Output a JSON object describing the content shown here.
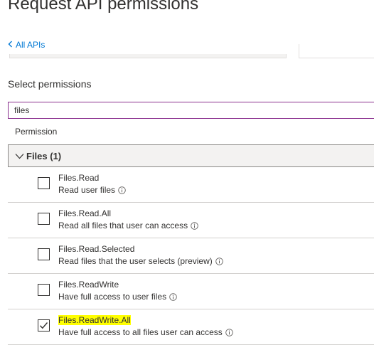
{
  "page": {
    "title": "Request API permissions"
  },
  "nav": {
    "back_label": "All APIs"
  },
  "select": {
    "label": "Select permissions"
  },
  "search": {
    "value": "files",
    "placeholder": ""
  },
  "table": {
    "column_header": "Permission"
  },
  "group": {
    "label": "Files (1)",
    "expanded": true
  },
  "permissions": [
    {
      "name": "Files.Read",
      "description": "Read user files",
      "checked": false,
      "highlighted": false
    },
    {
      "name": "Files.Read.All",
      "description": "Read all files that user can access",
      "checked": false,
      "highlighted": false
    },
    {
      "name": "Files.Read.Selected",
      "description": "Read files that the user selects (preview)",
      "checked": false,
      "highlighted": false
    },
    {
      "name": "Files.ReadWrite",
      "description": "Have full access to user files",
      "checked": false,
      "highlighted": false
    },
    {
      "name": "Files.ReadWrite.All",
      "description": "Have full access to all files user can access",
      "checked": true,
      "highlighted": true
    }
  ],
  "colors": {
    "link": "#0078d4",
    "search_border": "#8a2f8e",
    "highlight": "#ffff00",
    "group_bg": "#f3f2f1"
  },
  "icons": {
    "back": "chevron-left-icon",
    "group_toggle": "chevron-down-icon",
    "info": "info-icon",
    "check": "checkmark-icon"
  }
}
